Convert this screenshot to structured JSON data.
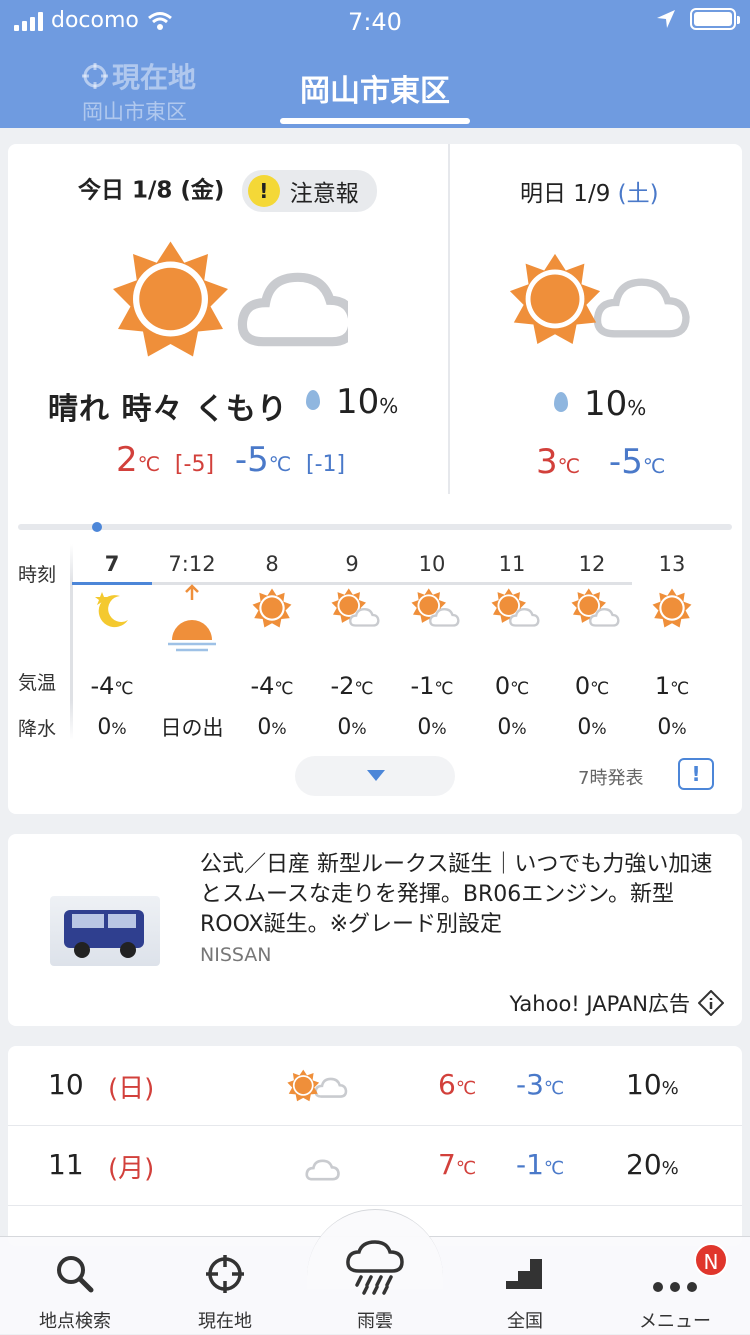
{
  "status_bar": {
    "carrier": "docomo",
    "time": "7:40"
  },
  "header": {
    "location_tab": {
      "title": "現在地",
      "subtitle": "岡山市東区"
    },
    "current_tab": "岡山市東区"
  },
  "today": {
    "label": "今日 1/8 (金)",
    "alert": {
      "icon": "!",
      "label": "注意報"
    },
    "weather": "晴れ 時々 くもり",
    "precip": "10",
    "precip_unit": "%",
    "high": "2",
    "high_diff": "[-5]",
    "low": "-5",
    "low_diff": "[-1]",
    "unit": "℃",
    "icon": "sun-cloud-icon"
  },
  "tomorrow": {
    "label": "明日 1/9",
    "dow": "(土)",
    "precip": "10",
    "precip_unit": "%",
    "high": "3",
    "low": "-5",
    "unit": "℃",
    "icon": "sun-cloud-icon"
  },
  "hourly": {
    "row_labels": {
      "time": "時刻",
      "temp": "気温",
      "precip": "降水"
    },
    "items": [
      {
        "hour": "7",
        "icon": "moon-star-icon",
        "temp": "-4",
        "temp_unit": "℃",
        "precip": "0",
        "precip_unit": "%"
      },
      {
        "hour": "7:12",
        "icon": "sunrise-icon",
        "temp": "",
        "temp_unit": "",
        "precip": "日の出",
        "precip_unit": ""
      },
      {
        "hour": "8",
        "icon": "sun-icon",
        "temp": "-4",
        "temp_unit": "℃",
        "precip": "0",
        "precip_unit": "%"
      },
      {
        "hour": "9",
        "icon": "sun-cloud-icon",
        "temp": "-2",
        "temp_unit": "℃",
        "precip": "0",
        "precip_unit": "%"
      },
      {
        "hour": "10",
        "icon": "sun-cloud-icon",
        "temp": "-1",
        "temp_unit": "℃",
        "precip": "0",
        "precip_unit": "%"
      },
      {
        "hour": "11",
        "icon": "sun-cloud-icon",
        "temp": "0",
        "temp_unit": "℃",
        "precip": "0",
        "precip_unit": "%"
      },
      {
        "hour": "12",
        "icon": "sun-cloud-icon",
        "temp": "0",
        "temp_unit": "℃",
        "precip": "0",
        "precip_unit": "%"
      },
      {
        "hour": "13",
        "icon": "sun-icon",
        "temp": "1",
        "temp_unit": "℃",
        "precip": "0",
        "precip_unit": "%"
      }
    ],
    "issued": "7時発表",
    "feedback_icon": "!"
  },
  "ad": {
    "text": "公式／日産 新型ルークス誕生｜いつでも力強い加速とスムースな走りを発揮。BR06エンジン。新型ROOX誕生。※グレード別設定",
    "brand": "NISSAN",
    "label": "Yahoo! JAPAN広告"
  },
  "weekly": [
    {
      "day": "10",
      "dow": "(日)",
      "icon": "sun-cloud-icon",
      "high": "6",
      "low": "-3",
      "unit": "℃",
      "precip": "10",
      "precip_unit": "%"
    },
    {
      "day": "11",
      "dow": "(月)",
      "icon": "cloud-icon",
      "high": "7",
      "low": "-1",
      "unit": "℃",
      "precip": "20",
      "precip_unit": "%"
    }
  ],
  "tabbar": [
    {
      "label": "地点検索",
      "icon": "search-icon"
    },
    {
      "label": "現在地",
      "icon": "crosshair-icon"
    },
    {
      "label": "雨雲",
      "icon": "rain-cloud-icon"
    },
    {
      "label": "全国",
      "icon": "map-icon"
    },
    {
      "label": "メニュー",
      "icon": "more-icon",
      "badge": "N"
    }
  ],
  "colors": {
    "header": "#6f9be0",
    "accent": "#4c86d8",
    "high": "#d2403b",
    "low": "#4a79c9",
    "sun": "#ef8f3a"
  }
}
